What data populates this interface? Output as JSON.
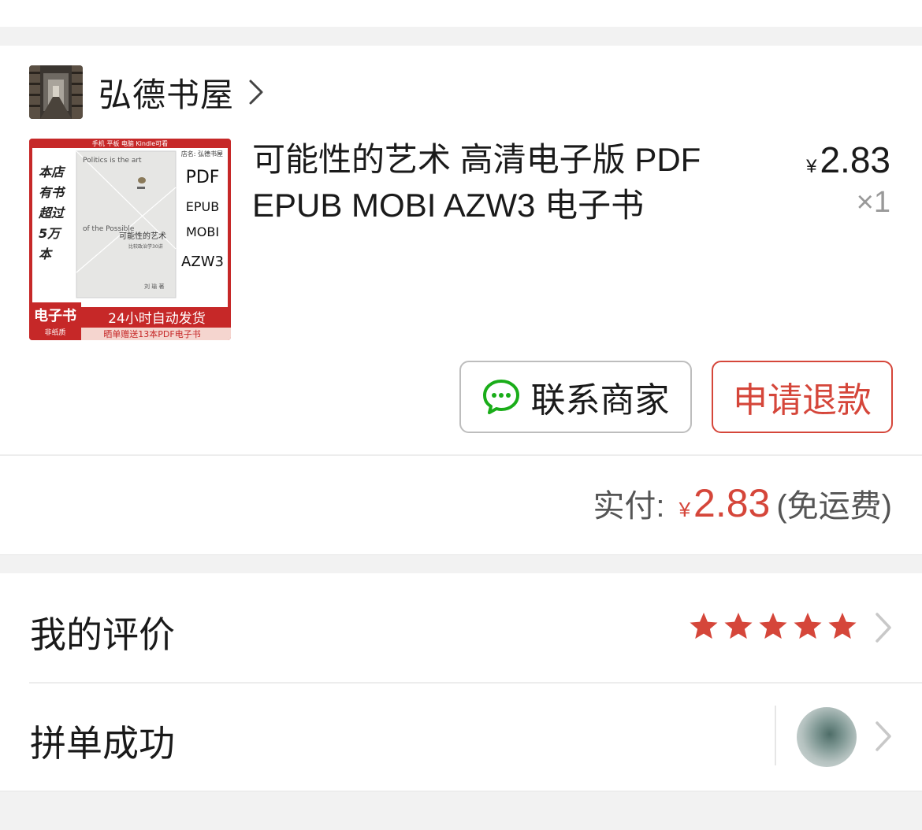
{
  "store": {
    "name": "弘德书屋",
    "avatar_icon": "bookstore-thumbnail"
  },
  "product": {
    "title": "可能性的艺术 高清电子版 PDF EPUB MOBI AZW3 电子书",
    "price_symbol": "¥",
    "price": "2.83",
    "quantity": "×1",
    "thumbnail": {
      "top_banner": "手机 平板 电脑 Kindle可看",
      "store_tag": "店名: 弘德书屋",
      "promo_lines": [
        "本店",
        "有书",
        "超过",
        "5万",
        "本"
      ],
      "book_en_top": "Politics is the art",
      "book_en_bottom": "of the Possible",
      "book_cn_title": "可能性的艺术",
      "book_cn_subtitle": "比较政治学30讲",
      "book_author": "刘 瑜 著",
      "formats": [
        "PDF",
        "EPUB",
        "MOBI",
        "AZW3"
      ],
      "badge": "电子书",
      "badge_sub": "非纸质",
      "delivery": "24小时自动发货",
      "bonus": "晒单赠送13本PDF电子书"
    }
  },
  "actions": {
    "contact_label": "联系商家",
    "refund_label": "申请退款"
  },
  "payment": {
    "label": "实付:",
    "symbol": "¥",
    "amount": "2.83",
    "note": "(免运费)"
  },
  "review": {
    "label": "我的评价",
    "stars": 5,
    "max_stars": 5
  },
  "group": {
    "label": "拼单成功"
  },
  "colors": {
    "accent": "#d5463a",
    "wechat_green": "#1aad19",
    "star": "#d5463a"
  }
}
